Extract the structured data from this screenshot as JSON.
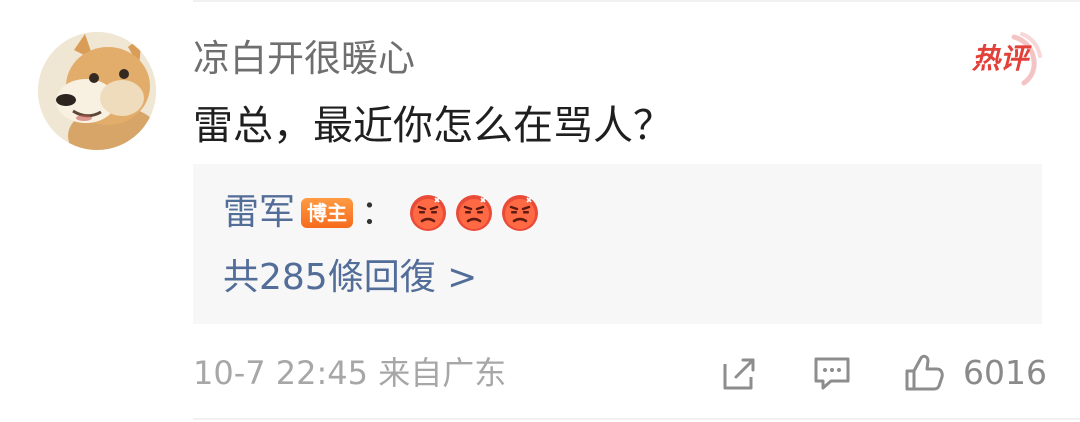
{
  "comment": {
    "username": "凉白开很暖心",
    "text": "雷总，最近你怎么在骂人？",
    "hot_badge": "热评",
    "avatar_icon": "shiba-inu-avatar"
  },
  "reply": {
    "author": "雷军",
    "badge": "博主",
    "colon": "：",
    "emoji_icons": [
      "angry-face-emoji",
      "angry-face-emoji",
      "angry-face-emoji"
    ],
    "count_text": "共285條回復 >"
  },
  "meta": {
    "time": "10-7 22:45",
    "location": "来自广东",
    "like_count": "6016"
  },
  "actions": {
    "share_icon": "share-icon",
    "comment_icon": "comment-icon",
    "like_icon": "thumbs-up-icon"
  },
  "colors": {
    "link_blue": "#536d99",
    "hot_red": "#e3403a",
    "badge_orange": "#f66b1c",
    "meta_gray": "#a7a7a7"
  }
}
